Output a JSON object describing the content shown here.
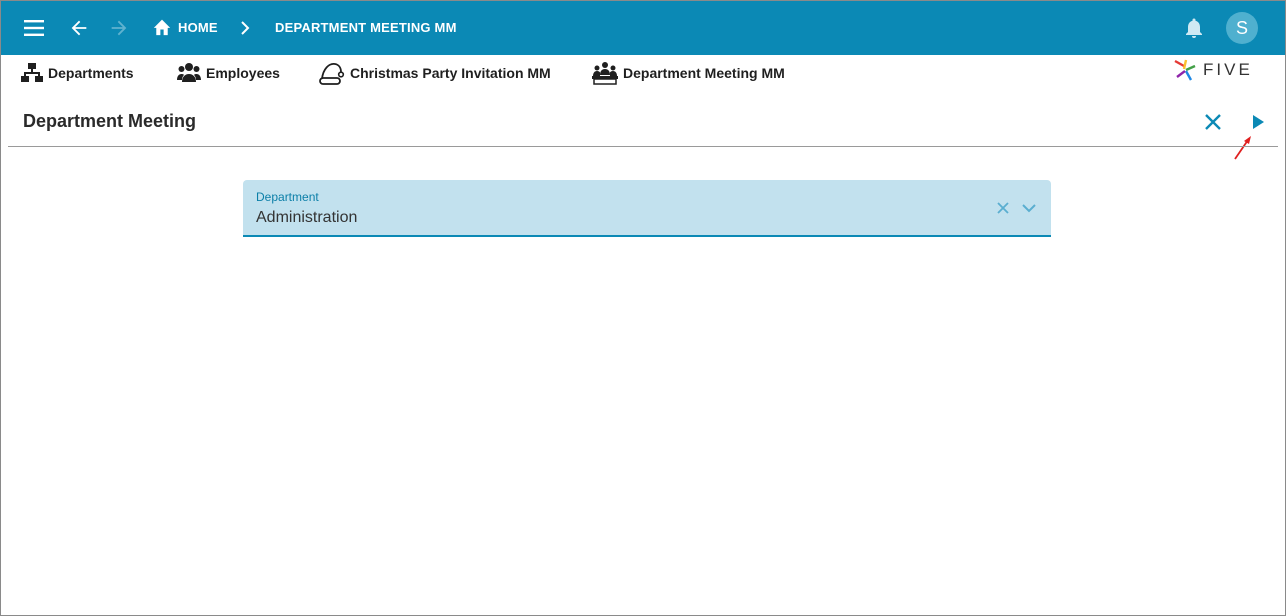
{
  "appbar": {
    "menu_icon": "menu-icon",
    "back_icon": "arrow-back-icon",
    "forward_icon": "arrow-forward-icon",
    "home_icon": "home-icon",
    "home_label": "HOME",
    "breadcrumb_separator_icon": "chevron-right-icon",
    "breadcrumb_current": "DEPARTMENT MEETING MM",
    "notification_icon": "bell-icon",
    "avatar_initial": "S",
    "bar_color": "#0b89b5"
  },
  "menubar": {
    "items": [
      {
        "label": "Departments",
        "icon": "org-chart-icon"
      },
      {
        "label": "Employees",
        "icon": "users-icon"
      },
      {
        "label": "Christmas Party Invitation MM",
        "icon": "santa-hat-icon"
      },
      {
        "label": "Department Meeting MM",
        "icon": "meeting-icon"
      }
    ],
    "logo_text": "FIVE"
  },
  "form": {
    "title": "Department Meeting",
    "close_icon": "close-icon",
    "run_icon": "play-icon",
    "fields": [
      {
        "label": "Department",
        "value": "Administration"
      }
    ]
  }
}
